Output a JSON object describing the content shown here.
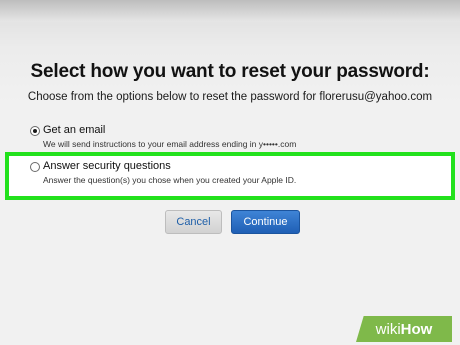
{
  "page": {
    "title": "Select how you want to reset your password:",
    "subtitle": "Choose from the options below to reset the password for florerusu@yahoo.com"
  },
  "options": [
    {
      "label": "Get an email",
      "description": "We will send instructions to your email address ending in y•••••.com",
      "selected": true
    },
    {
      "label": "Answer security questions",
      "description": "Answer the question(s) you chose when you created your Apple ID.",
      "selected": false
    }
  ],
  "buttons": {
    "cancel": "Cancel",
    "continue": "Continue"
  },
  "watermark": {
    "prefix": "wiki",
    "suffix": "How"
  },
  "colors": {
    "highlight": "#22e11c",
    "primary_button": "#2a6fc4",
    "watermark_bg": "#7fb94a"
  }
}
